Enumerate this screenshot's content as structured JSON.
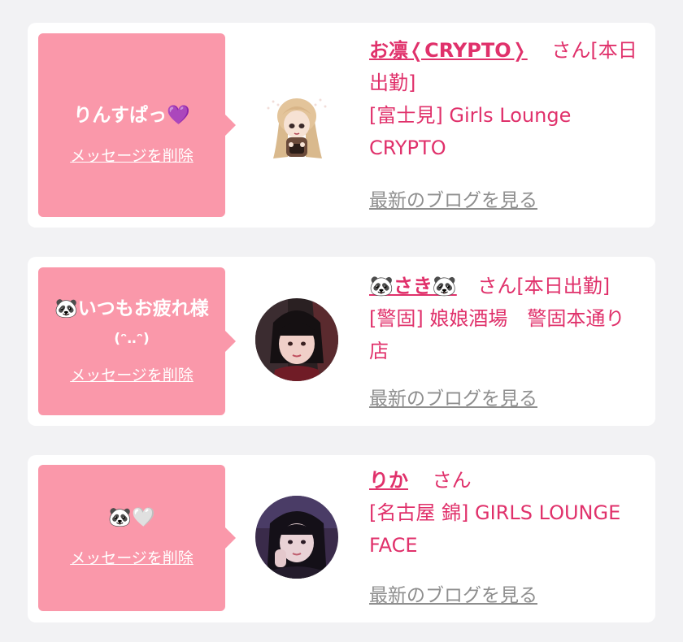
{
  "common": {
    "delete_label": "メッセージを削除",
    "blog_label": "最新のブログを見る",
    "san_label": "さん"
  },
  "colors": {
    "background": "#f2f2f4",
    "card": "#ffffff",
    "bubble": "#fa98aa",
    "accent": "#e0316b",
    "link_gray": "#8e8e8e"
  },
  "messages": [
    {
      "message": "りんすぱっ💜",
      "message_sub": "",
      "cast_name": "お凛❬CRYPTO❭",
      "status": "[本日出勤]",
      "shop": "[富士見] Girls Lounge CRYPTO",
      "avatar_icon": "anime-girl-avatar-icon"
    },
    {
      "message": "🐼いつもお疲れ様",
      "message_sub": "(ᵔ‥ᵔ)",
      "cast_name": "🐼さき🐼",
      "status": "[本日出勤]",
      "shop": "[警固] 娘娘酒場　警固本通り店",
      "avatar_icon": "profile-photo-icon"
    },
    {
      "message": "🐼🤍",
      "message_sub": "",
      "cast_name": "りか",
      "status": "",
      "shop": "[名古屋 錦] GIRLS LOUNGE FACE",
      "avatar_icon": "profile-photo-icon"
    }
  ]
}
